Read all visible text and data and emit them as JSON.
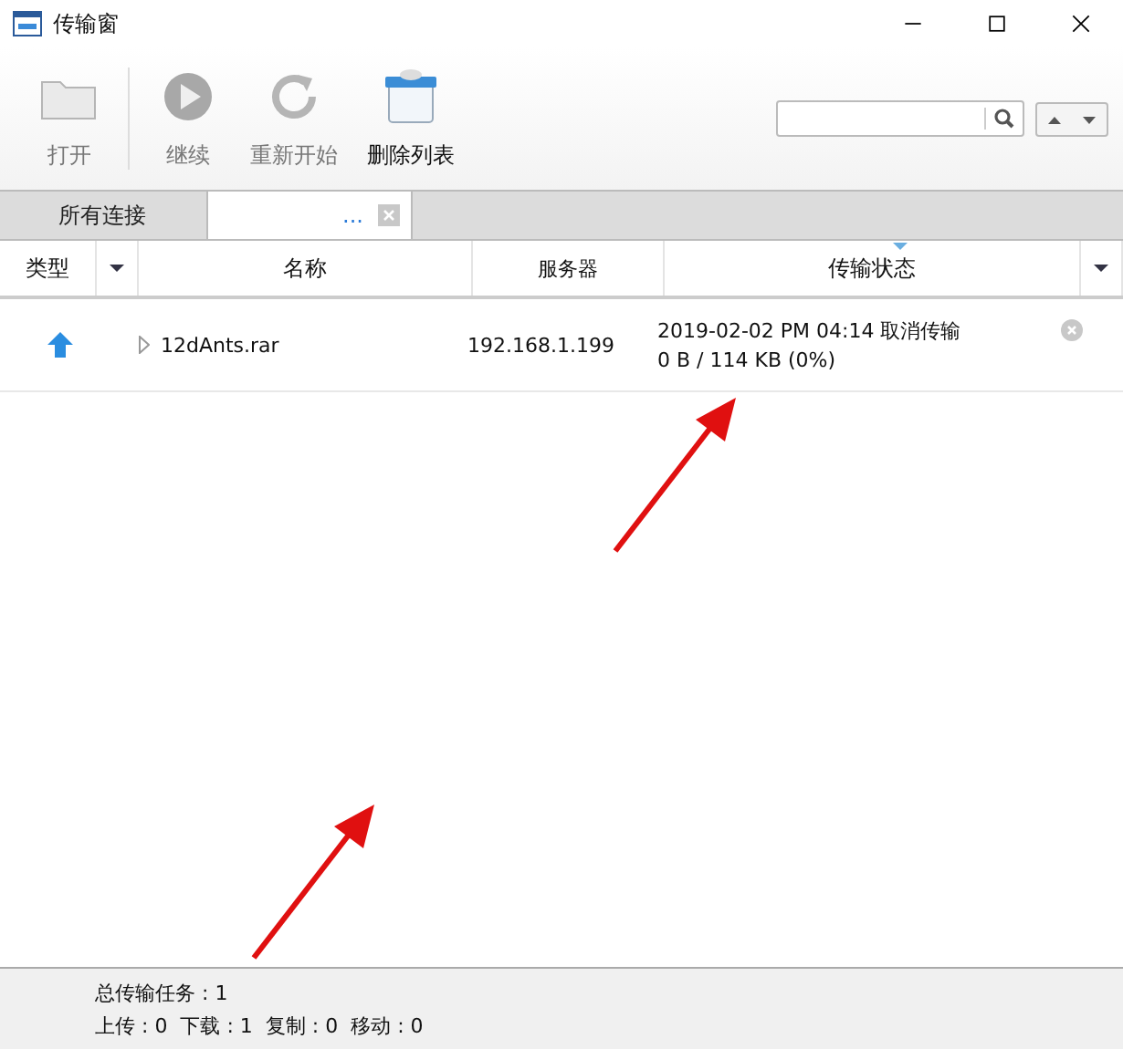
{
  "window": {
    "title": "传输窗"
  },
  "toolbar": [
    {
      "label": "打开",
      "kind": "open",
      "disabled": true
    },
    {
      "label": "继续",
      "kind": "resume",
      "disabled": true
    },
    {
      "label": "重新开始",
      "kind": "restart",
      "disabled": true
    },
    {
      "label": "删除列表",
      "kind": "delete",
      "disabled": false
    }
  ],
  "tabs": [
    {
      "label": "所有连接",
      "selected": false,
      "closable": false
    },
    {
      "label": "...",
      "selected": true,
      "closable": true
    }
  ],
  "table": {
    "columns": [
      {
        "label": "类型",
        "menu": true
      },
      {
        "label": "名称",
        "menu": false
      },
      {
        "label": "服务器",
        "menu": false
      },
      {
        "label": "传输状态",
        "menu": true,
        "sorted": true
      }
    ],
    "rows": [
      {
        "kind": "upload",
        "name": "12dAnts.rar",
        "server": "192.168.1.199",
        "status_line": "2019-02-02 PM 04:14 取消传输",
        "progress": "0 B / 114 KB (0%)"
      }
    ]
  },
  "annotations": [
    {
      "kind": "arrow"
    },
    {
      "kind": "arrow"
    }
  ],
  "status_bar": {
    "total": "总传输任务 : 1",
    "details": "上传 : 0  下载 : 1  复制 : 0  移动 : 0"
  }
}
